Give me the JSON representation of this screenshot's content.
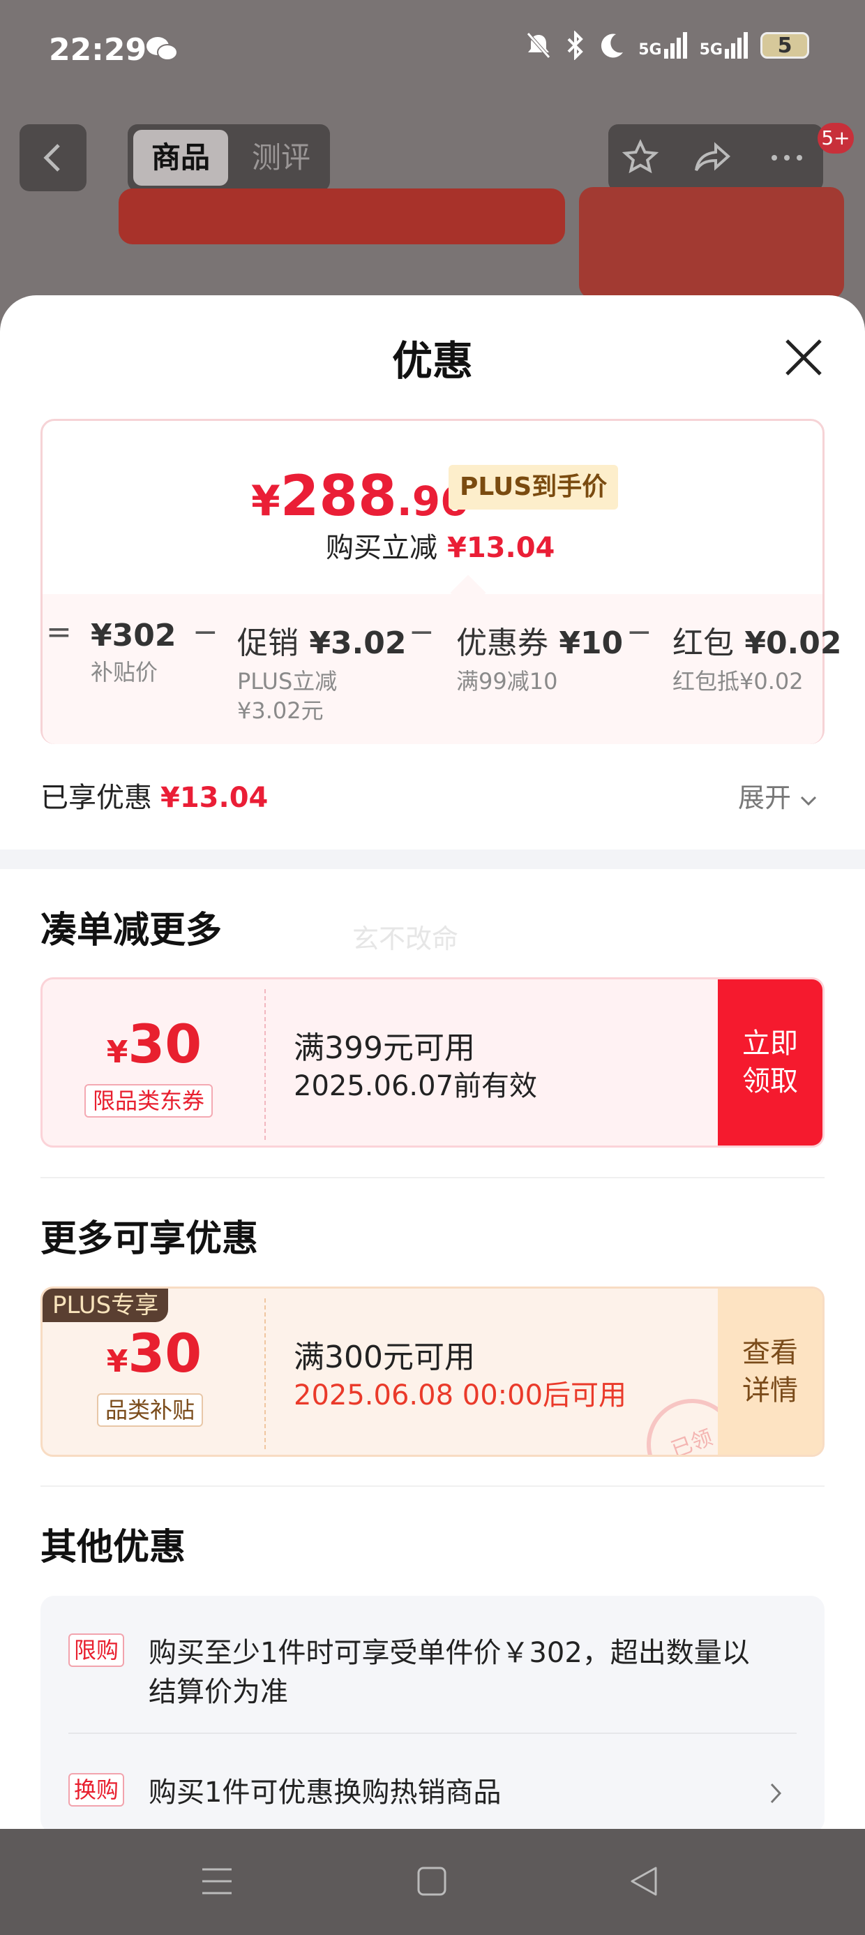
{
  "status_bar": {
    "time": "22:29",
    "signal_1": "5G",
    "signal_2": "5G",
    "battery": "5"
  },
  "header": {
    "tab_product": "商品",
    "tab_review": "测评",
    "cart_badge": "5+"
  },
  "sheet": {
    "title": "优惠",
    "price": {
      "currency": "¥",
      "integer": "288",
      "decimal": ".96",
      "tag": "PLUS到手价"
    },
    "purchase_discount": {
      "label": "购买立减",
      "value": "¥13.04"
    },
    "breakdown": [
      {
        "op": "=",
        "value": "¥302",
        "prefix": "",
        "sub": "补贴价"
      },
      {
        "op": "−",
        "value": "¥3.02",
        "prefix": "促销",
        "sub": "PLUS立减",
        "sub2": "¥3.02元"
      },
      {
        "op": "−",
        "value": "¥10",
        "prefix": "优惠券",
        "sub": "满99减10"
      },
      {
        "op": "−",
        "value": "¥0.02",
        "prefix": "红包",
        "sub": "红包抵¥0.02"
      }
    ],
    "enjoyed": {
      "label": "已享优惠",
      "value": "¥13.04"
    },
    "expand_label": "展开",
    "section_combine": "凑单减更多",
    "watermark": "玄不改命",
    "coupon1": {
      "currency": "¥",
      "amount": "30",
      "tag": "限品类东券",
      "condition": "满399元可用",
      "validity": "2025.06.07前有效",
      "button": "立即领取"
    },
    "section_more": "更多可享优惠",
    "coupon2": {
      "ribbon": "PLUS专享",
      "currency": "¥",
      "amount": "30",
      "tag": "品类补贴",
      "condition": "满300元可用",
      "validity": "2025.06.08 00:00后可用",
      "button": "查看详情",
      "stamp": "已领"
    },
    "section_other": "其他优惠",
    "other": [
      {
        "tag": "限购",
        "text": "购买至少1件时可享受单件价￥302，超出数量以结算价为准"
      },
      {
        "tag": "换购",
        "text": "购买1件可优惠换购热销商品"
      }
    ]
  }
}
